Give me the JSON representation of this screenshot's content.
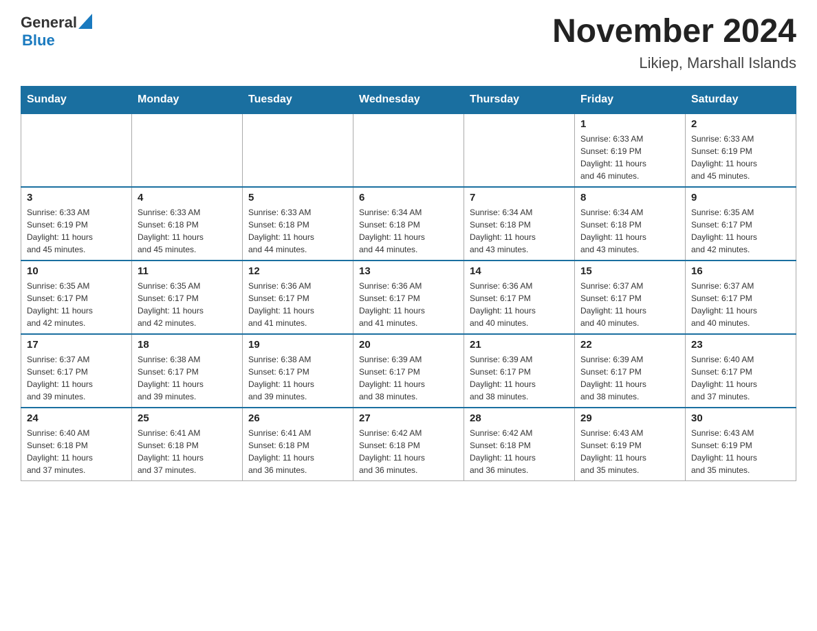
{
  "header": {
    "logo_general": "General",
    "logo_blue": "Blue",
    "title": "November 2024",
    "subtitle": "Likiep, Marshall Islands"
  },
  "days_of_week": [
    "Sunday",
    "Monday",
    "Tuesday",
    "Wednesday",
    "Thursday",
    "Friday",
    "Saturday"
  ],
  "weeks": [
    [
      {
        "day": "",
        "info": ""
      },
      {
        "day": "",
        "info": ""
      },
      {
        "day": "",
        "info": ""
      },
      {
        "day": "",
        "info": ""
      },
      {
        "day": "",
        "info": ""
      },
      {
        "day": "1",
        "info": "Sunrise: 6:33 AM\nSunset: 6:19 PM\nDaylight: 11 hours\nand 46 minutes."
      },
      {
        "day": "2",
        "info": "Sunrise: 6:33 AM\nSunset: 6:19 PM\nDaylight: 11 hours\nand 45 minutes."
      }
    ],
    [
      {
        "day": "3",
        "info": "Sunrise: 6:33 AM\nSunset: 6:19 PM\nDaylight: 11 hours\nand 45 minutes."
      },
      {
        "day": "4",
        "info": "Sunrise: 6:33 AM\nSunset: 6:18 PM\nDaylight: 11 hours\nand 45 minutes."
      },
      {
        "day": "5",
        "info": "Sunrise: 6:33 AM\nSunset: 6:18 PM\nDaylight: 11 hours\nand 44 minutes."
      },
      {
        "day": "6",
        "info": "Sunrise: 6:34 AM\nSunset: 6:18 PM\nDaylight: 11 hours\nand 44 minutes."
      },
      {
        "day": "7",
        "info": "Sunrise: 6:34 AM\nSunset: 6:18 PM\nDaylight: 11 hours\nand 43 minutes."
      },
      {
        "day": "8",
        "info": "Sunrise: 6:34 AM\nSunset: 6:18 PM\nDaylight: 11 hours\nand 43 minutes."
      },
      {
        "day": "9",
        "info": "Sunrise: 6:35 AM\nSunset: 6:17 PM\nDaylight: 11 hours\nand 42 minutes."
      }
    ],
    [
      {
        "day": "10",
        "info": "Sunrise: 6:35 AM\nSunset: 6:17 PM\nDaylight: 11 hours\nand 42 minutes."
      },
      {
        "day": "11",
        "info": "Sunrise: 6:35 AM\nSunset: 6:17 PM\nDaylight: 11 hours\nand 42 minutes."
      },
      {
        "day": "12",
        "info": "Sunrise: 6:36 AM\nSunset: 6:17 PM\nDaylight: 11 hours\nand 41 minutes."
      },
      {
        "day": "13",
        "info": "Sunrise: 6:36 AM\nSunset: 6:17 PM\nDaylight: 11 hours\nand 41 minutes."
      },
      {
        "day": "14",
        "info": "Sunrise: 6:36 AM\nSunset: 6:17 PM\nDaylight: 11 hours\nand 40 minutes."
      },
      {
        "day": "15",
        "info": "Sunrise: 6:37 AM\nSunset: 6:17 PM\nDaylight: 11 hours\nand 40 minutes."
      },
      {
        "day": "16",
        "info": "Sunrise: 6:37 AM\nSunset: 6:17 PM\nDaylight: 11 hours\nand 40 minutes."
      }
    ],
    [
      {
        "day": "17",
        "info": "Sunrise: 6:37 AM\nSunset: 6:17 PM\nDaylight: 11 hours\nand 39 minutes."
      },
      {
        "day": "18",
        "info": "Sunrise: 6:38 AM\nSunset: 6:17 PM\nDaylight: 11 hours\nand 39 minutes."
      },
      {
        "day": "19",
        "info": "Sunrise: 6:38 AM\nSunset: 6:17 PM\nDaylight: 11 hours\nand 39 minutes."
      },
      {
        "day": "20",
        "info": "Sunrise: 6:39 AM\nSunset: 6:17 PM\nDaylight: 11 hours\nand 38 minutes."
      },
      {
        "day": "21",
        "info": "Sunrise: 6:39 AM\nSunset: 6:17 PM\nDaylight: 11 hours\nand 38 minutes."
      },
      {
        "day": "22",
        "info": "Sunrise: 6:39 AM\nSunset: 6:17 PM\nDaylight: 11 hours\nand 38 minutes."
      },
      {
        "day": "23",
        "info": "Sunrise: 6:40 AM\nSunset: 6:17 PM\nDaylight: 11 hours\nand 37 minutes."
      }
    ],
    [
      {
        "day": "24",
        "info": "Sunrise: 6:40 AM\nSunset: 6:18 PM\nDaylight: 11 hours\nand 37 minutes."
      },
      {
        "day": "25",
        "info": "Sunrise: 6:41 AM\nSunset: 6:18 PM\nDaylight: 11 hours\nand 37 minutes."
      },
      {
        "day": "26",
        "info": "Sunrise: 6:41 AM\nSunset: 6:18 PM\nDaylight: 11 hours\nand 36 minutes."
      },
      {
        "day": "27",
        "info": "Sunrise: 6:42 AM\nSunset: 6:18 PM\nDaylight: 11 hours\nand 36 minutes."
      },
      {
        "day": "28",
        "info": "Sunrise: 6:42 AM\nSunset: 6:18 PM\nDaylight: 11 hours\nand 36 minutes."
      },
      {
        "day": "29",
        "info": "Sunrise: 6:43 AM\nSunset: 6:19 PM\nDaylight: 11 hours\nand 35 minutes."
      },
      {
        "day": "30",
        "info": "Sunrise: 6:43 AM\nSunset: 6:19 PM\nDaylight: 11 hours\nand 35 minutes."
      }
    ]
  ]
}
